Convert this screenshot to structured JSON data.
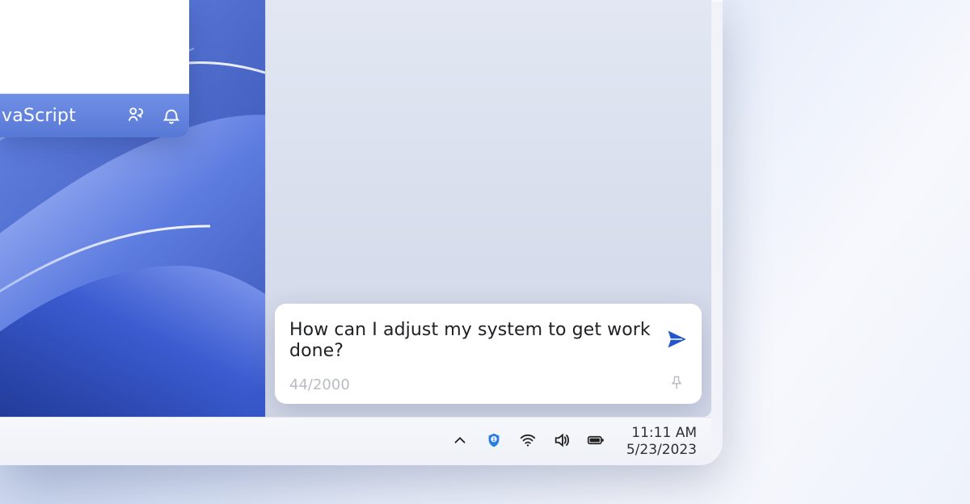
{
  "app_card": {
    "language_label": "vaScript"
  },
  "copilot": {
    "prompt_value": "How can I adjust my system to get work done?",
    "counter": "44/2000"
  },
  "taskbar": {
    "time": "11:11 AM",
    "date": "5/23/2023"
  },
  "icons": {
    "share": "share-icon",
    "bell": "bell-icon",
    "send": "send-icon",
    "pin": "pin-icon",
    "chevron_up": "chevron-up-icon",
    "shield": "security-shield-icon",
    "wifi": "wifi-icon",
    "volume": "volume-icon",
    "battery": "battery-icon"
  },
  "colors": {
    "accent": "#2156cf"
  }
}
